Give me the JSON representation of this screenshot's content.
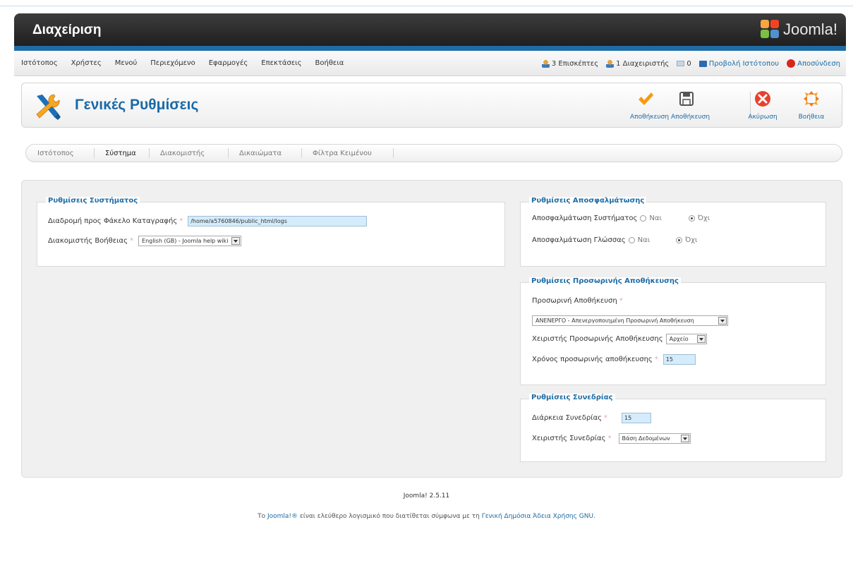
{
  "header": {
    "title": "Διαχείριση",
    "logo_text": "Joomla!"
  },
  "menu": [
    "Ιστότοπος",
    "Χρήστες",
    "Μενού",
    "Περιεχόμενο",
    "Εφαρμογές",
    "Επεκτάσεις",
    "Βοήθεια"
  ],
  "status": {
    "visitors": "3 Επισκέπτες",
    "admins": "1 Διαχειριστής",
    "messages": "0",
    "view_site": "Προβολή Ιστότοπου",
    "logout": "Αποσύνδεση"
  },
  "toolbar": {
    "page_title": "Γενικές Ρυθμίσεις",
    "save_close": "Αποθήκευση",
    "save": "Αποθήκευση",
    "cancel": "Ακύρωση",
    "help": "Βοήθεια"
  },
  "tabs": [
    "Ιστότοπος",
    "Σύστημα",
    "Διακομιστής",
    "Δικαιώματα",
    "Φίλτρα Κειμένου"
  ],
  "system_settings": {
    "legend": "Ρυθμίσεις Συστήματος",
    "log_path_label": "Διαδρομή προς Φάκελο Καταγραφής",
    "log_path_value": "/home/a5760846/public_html/logs",
    "help_server_label": "Διακομιστής Βοήθειας",
    "help_server_value": "English (GB) - Joomla help wiki"
  },
  "debug_settings": {
    "legend": "Ρυθμίσεις Αποσφαλμάτωσης",
    "system_debug_label": "Αποσφαλμάτωση Συστήματος",
    "language_debug_label": "Αποσφαλμάτωση Γλώσσας",
    "yes": "Ναι",
    "no": "Όχι",
    "system_debug_no": "Όχι"
  },
  "cache_settings": {
    "legend": "Ρυθμίσεις Προσωρινής Αποθήκευσης",
    "cache_label": "Προσωρινή Αποθήκευση",
    "cache_value": "ΑΝΕΝΕΡΓΟ - Απενεργοποιημένη Προσωρινή Αποθήκευση",
    "handler_label": "Χειριστής Προσωρινής Αποθήκευσης",
    "handler_value": "Αρχείο",
    "time_label": "Χρόνος προσωρινής αποθήκευσης",
    "time_value": "15"
  },
  "session_settings": {
    "legend": "Ρυθμίσεις Συνεδρίας",
    "lifetime_label": "Διάρκεια Συνεδρίας",
    "lifetime_value": "15",
    "handler_label": "Χειριστής Συνεδρίας",
    "handler_value": "Βάση Δεδομένων"
  },
  "footer": {
    "version": "Joomla! 2.5.11",
    "license_prefix": "Το",
    "joomla_link": "Joomla!®",
    "license_middle": "είναι ελεύθερο λογισμικό που διατίθεται σύμφωνα με τη",
    "license_link": "Γενική Δημόσια Άδεια Χρήσης GNU."
  },
  "colors": {
    "accent": "#1d6ca5",
    "header_bg": "#2b2b2b",
    "field_bg": "#d4ecfb"
  }
}
